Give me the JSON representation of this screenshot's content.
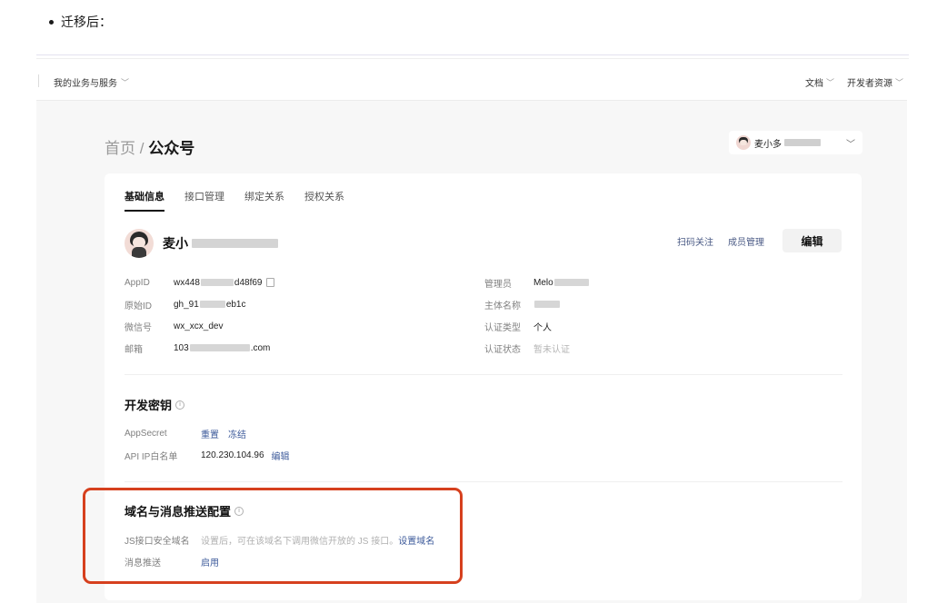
{
  "doc": {
    "bullet_text": "迁移后："
  },
  "topnav": {
    "business_menu": "我的业务与服务",
    "docs": "文档",
    "dev_resources": "开发者资源"
  },
  "breadcrumb": {
    "home": "首页",
    "separator": "/",
    "current": "公众号"
  },
  "account": {
    "name_prefix": "麦小多"
  },
  "tabs": [
    {
      "label": "基础信息",
      "active": true
    },
    {
      "label": "接口管理",
      "active": false
    },
    {
      "label": "绑定关系",
      "active": false
    },
    {
      "label": "授权关系",
      "active": false
    }
  ],
  "profile": {
    "name_prefix": "麦小",
    "scan_follow": "扫码关注",
    "member_mgmt": "成员管理",
    "edit": "编辑"
  },
  "basic_info": {
    "left": [
      {
        "label": "AppID",
        "value_start": "wx448",
        "value_end": "d48f69"
      },
      {
        "label": "原始ID",
        "value_start": "gh_91",
        "value_end": "eb1c"
      },
      {
        "label": "微信号",
        "value": "wx_xcx_dev"
      },
      {
        "label": "邮箱",
        "value_start": "103",
        "value_end": ".com"
      }
    ],
    "right": [
      {
        "label": "管理员",
        "value": "Melo"
      },
      {
        "label": "主体名称",
        "value": ""
      },
      {
        "label": "认证类型",
        "value": "个人"
      },
      {
        "label": "认证状态",
        "value": "暂未认证"
      }
    ]
  },
  "dev_secret": {
    "title": "开发密钥",
    "appsecret_label": "AppSecret",
    "reset": "重置",
    "freeze": "冻结",
    "ip_label": "API IP白名单",
    "ip_value": "120.230.104.96",
    "ip_edit": "编辑"
  },
  "domain_config": {
    "title": "域名与消息推送配置",
    "js_label": "JS接口安全域名",
    "js_desc": "设置后，可在该域名下调用微信开放的 JS 接口。",
    "js_link": "设置域名",
    "push_label": "消息推送",
    "push_link": "启用"
  },
  "colors": {
    "highlight_border": "#d6401e",
    "link": "#3e5b9b",
    "page_bg": "#f7f7f7"
  }
}
